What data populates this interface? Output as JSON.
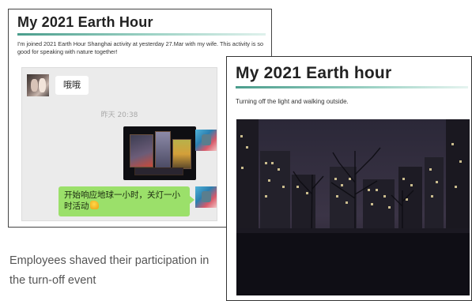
{
  "left_card": {
    "title": "My 2021 Earth Hour",
    "description": "I'm joined 2021 Earth Hour Shanghai activity at yesterday 27.Mar with my wife. This activity is so good for speaking with nature together!",
    "chat": {
      "incoming_message": "哦哦",
      "timestamp": "昨天 20:38",
      "outgoing_message": "开始响应地球一小时，关灯一小时活动"
    }
  },
  "caption": "Employees shaved their participation in the turn-off event",
  "right_card": {
    "title": "My 2021 Earth hour",
    "description": "Turning off the light and walking outside."
  },
  "colors": {
    "title_rule": "#4a9d8c",
    "chat_background": "#ebebeb",
    "outgoing_bubble": "#9be06a"
  }
}
